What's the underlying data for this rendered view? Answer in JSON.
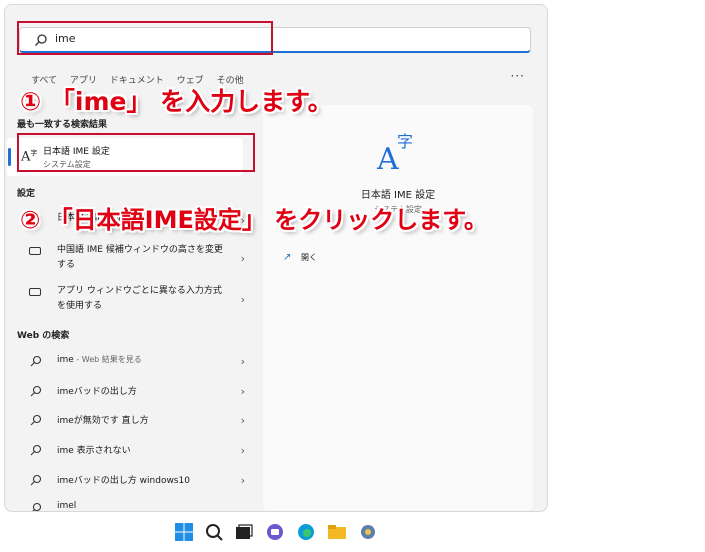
{
  "search": {
    "query": "ime"
  },
  "filters": [
    "すべて",
    "アプリ",
    "ドキュメント",
    "ウェブ",
    "その他"
  ],
  "more_label": "···",
  "best_match": {
    "heading": "最も一致する検索結果",
    "title": "日本語 IME 設定",
    "subtitle": "システム設定"
  },
  "settings": {
    "heading": "設定",
    "items": [
      {
        "label": "日本語 IME 設定"
      },
      {
        "label": "中国語 IME 候補ウィンドウの高さを変更する"
      },
      {
        "label": "アプリ ウィンドウごとに異なる入力方式を使用する"
      }
    ]
  },
  "web": {
    "heading": "Web の検索",
    "items": [
      {
        "label": "ime",
        "suffix": " - Web 結果を見る"
      },
      {
        "label": "imeバッドの出し方",
        "suffix": ""
      },
      {
        "label": "imeが無効です 直し方",
        "suffix": ""
      },
      {
        "label": "ime 表示されない",
        "suffix": ""
      },
      {
        "label": "imeバッドの出し方 windows10",
        "suffix": ""
      },
      {
        "label": "imel",
        "suffix": ""
      }
    ]
  },
  "detail": {
    "title": "日本語 IME 設定",
    "subtitle": "システム設定",
    "open_label": "開く"
  },
  "annotations": {
    "step1": "① 「ime」 を入力します。",
    "step2": "② 「日本語IME設定」 をクリックします。"
  },
  "colors": {
    "accent": "#1f6fd6",
    "annotation": "#e00012",
    "highlight_box": "#c8102e"
  }
}
